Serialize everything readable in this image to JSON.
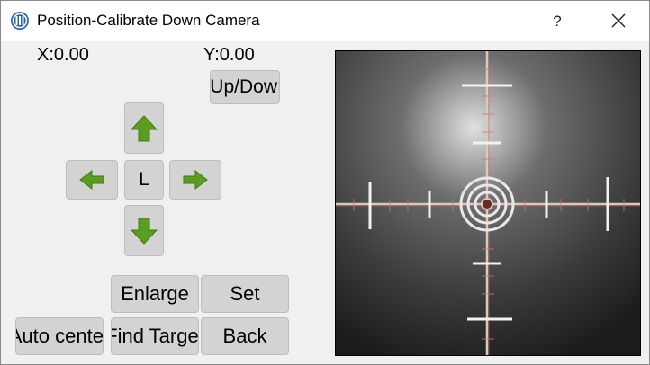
{
  "window": {
    "title": "Position-Calibrate Down Camera",
    "icon": "app-logo-icon",
    "help_label": "?",
    "close_icon": "close-icon"
  },
  "coords": {
    "x_label": "X:0.00",
    "y_label": "Y:0.00"
  },
  "buttons": {
    "updown": "Up/Dow",
    "center": "L",
    "enlarge": "Enlarge",
    "set": "Set",
    "auto_center": "Auto center",
    "find_target": "Find Target",
    "back": "Back"
  },
  "arrows": {
    "up": "arrow-up-icon",
    "down": "arrow-down-icon",
    "left": "arrow-left-icon",
    "right": "arrow-right-icon",
    "color": "#5a9e1f"
  },
  "camera": {
    "feed": "camera-feed-calibration-target"
  }
}
